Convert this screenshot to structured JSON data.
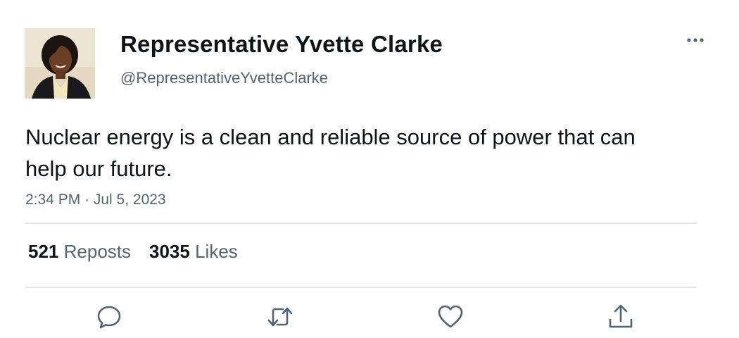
{
  "author": {
    "display_name": "Representative Yvette Clarke",
    "handle": "@RepresentativeYvetteClarke",
    "avatar_icon": "profile-photo"
  },
  "tweet": {
    "text": "Nuclear energy is a clean and reliable source of power that can help our future.",
    "timestamp": "2:34 PM · Jul 5, 2023"
  },
  "stats": {
    "reposts_count": "521",
    "reposts_label": "Reposts",
    "likes_count": "3035",
    "likes_label": "Likes"
  },
  "actions": [
    {
      "icon": "reply-icon"
    },
    {
      "icon": "repost-icon"
    },
    {
      "icon": "like-icon"
    },
    {
      "icon": "share-icon"
    }
  ],
  "colors": {
    "text_primary": "#0f1419",
    "text_secondary": "#536471",
    "divider": "#e4e8eb",
    "icon": "#536471"
  }
}
